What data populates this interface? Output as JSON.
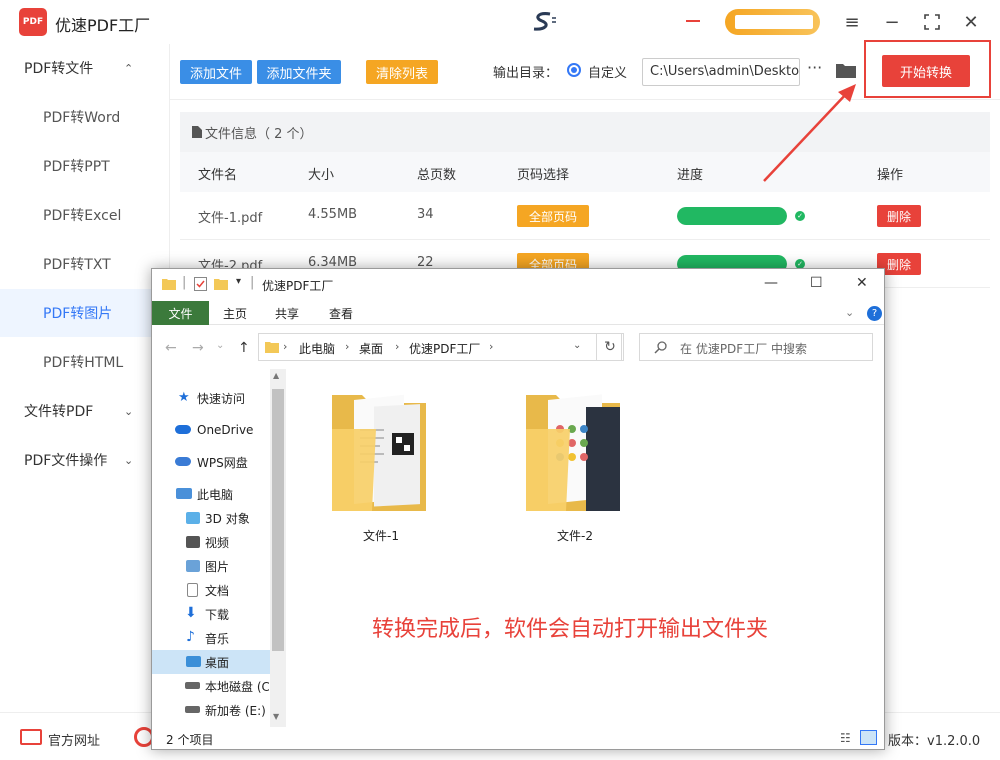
{
  "app": {
    "title": "优速PDF工厂",
    "logo_text": "PDF",
    "version": "版本：v1.2.0.0",
    "footer_link": "官方网址"
  },
  "sidebar": {
    "items": [
      {
        "label": "PDF转文件",
        "type": "group",
        "expanded": true
      },
      {
        "label": "PDF转Word",
        "type": "sub"
      },
      {
        "label": "PDF转PPT",
        "type": "sub"
      },
      {
        "label": "PDF转Excel",
        "type": "sub"
      },
      {
        "label": "PDF转TXT",
        "type": "sub"
      },
      {
        "label": "PDF转图片",
        "type": "sub",
        "active": true
      },
      {
        "label": "PDF转HTML",
        "type": "sub"
      },
      {
        "label": "文件转PDF",
        "type": "group",
        "expanded": false
      },
      {
        "label": "PDF文件操作",
        "type": "group",
        "expanded": false
      }
    ]
  },
  "toolbar": {
    "add_file": "添加文件",
    "add_folder": "添加文件夹",
    "clear_list": "清除列表",
    "output_label": "输出目录：",
    "radio_label": "自定义",
    "output_path": "C:\\Users\\admin\\Deskto",
    "more": "···",
    "start": "开始转换"
  },
  "fileinfo": {
    "label": "文件信息（ 2 个）"
  },
  "table": {
    "headers": [
      "文件名",
      "大小",
      "总页数",
      "页码选择",
      "进度",
      "操作"
    ],
    "rows": [
      {
        "name": "文件-1.pdf",
        "size": "4.55MB",
        "pages": "34",
        "page_select": "全部页码",
        "progress": 1.0,
        "action": "删除"
      },
      {
        "name": "文件-2.pdf",
        "size": "6.34MB",
        "pages": "22",
        "page_select": "全部页码",
        "progress": 1.0,
        "action": "删除"
      }
    ]
  },
  "explorer": {
    "title": "优速PDF工厂",
    "ribbon_tabs": [
      "文件",
      "主页",
      "共享",
      "查看"
    ],
    "breadcrumb": [
      "此电脑",
      "桌面",
      "优速PDF工厂"
    ],
    "search_placeholder": "在 优速PDF工厂 中搜索",
    "nav_items": [
      {
        "label": "快速访问",
        "icon": "star-icon",
        "color": "#1e6fd9"
      },
      {
        "label": "OneDrive",
        "icon": "cloud-icon",
        "color": "#1e6fd9"
      },
      {
        "label": "WPS网盘",
        "icon": "cloud-icon",
        "color": "#3a7bd5"
      },
      {
        "label": "此电脑",
        "icon": "computer-icon",
        "color": "#4a90d9"
      },
      {
        "label": "3D 对象",
        "icon": "cube-icon",
        "color": "#5bb0e8"
      },
      {
        "label": "视频",
        "icon": "film-icon",
        "color": "#555555"
      },
      {
        "label": "图片",
        "icon": "picture-icon",
        "color": "#6aa2d8"
      },
      {
        "label": "文档",
        "icon": "document-icon",
        "color": "#888888"
      },
      {
        "label": "下载",
        "icon": "download-icon",
        "color": "#1e6fd9"
      },
      {
        "label": "音乐",
        "icon": "music-icon",
        "color": "#1e6fd9"
      },
      {
        "label": "桌面",
        "icon": "desktop-icon",
        "color": "#3b8fd8",
        "selected": true
      },
      {
        "label": "本地磁盘 (C",
        "icon": "drive-icon",
        "color": "#666666"
      },
      {
        "label": "新加卷 (E:)",
        "icon": "drive-icon",
        "color": "#666666"
      }
    ],
    "folders": [
      {
        "name": "文件-1"
      },
      {
        "name": "文件-2"
      }
    ],
    "note": "转换完成后，软件会自动打开输出文件夹",
    "status": "2 个项目"
  },
  "colors": {
    "accent_red": "#e8423a",
    "blue": "#3a8ee6",
    "orange": "#f5a623",
    "green": "#21b862"
  }
}
